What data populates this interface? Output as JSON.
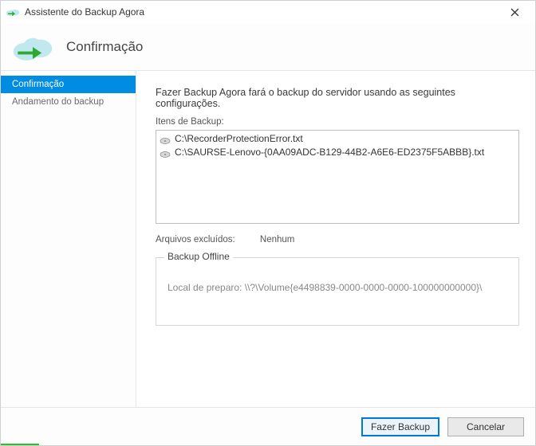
{
  "window": {
    "title": "Assistente do Backup Agora"
  },
  "header": {
    "title": "Confirmação"
  },
  "sidebar": {
    "items": [
      {
        "label": "Confirmação",
        "active": true
      },
      {
        "label": "Andamento do backup",
        "active": false
      }
    ]
  },
  "main": {
    "intro": "Fazer Backup Agora fará o backup do servidor usando as seguintes configurações.",
    "items_label": "Itens de Backup:",
    "files": [
      "C:\\RecorderProtectionError.txt",
      "C:\\SAURSE-Lenovo-{0AA09ADC-B129-44B2-A6E6-ED2375F5ABBB}.txt"
    ],
    "excluded_label": "Arquivos excluídos:",
    "excluded_value": "Nenhum",
    "offline": {
      "title": "Backup Offline",
      "staging_label": "Local de preparo:",
      "staging_path": "\\\\?\\Volume{e4498839-0000-0000-0000-100000000000}\\"
    }
  },
  "footer": {
    "primary": "Fazer Backup",
    "cancel": "Cancelar"
  },
  "accent_width": 48
}
